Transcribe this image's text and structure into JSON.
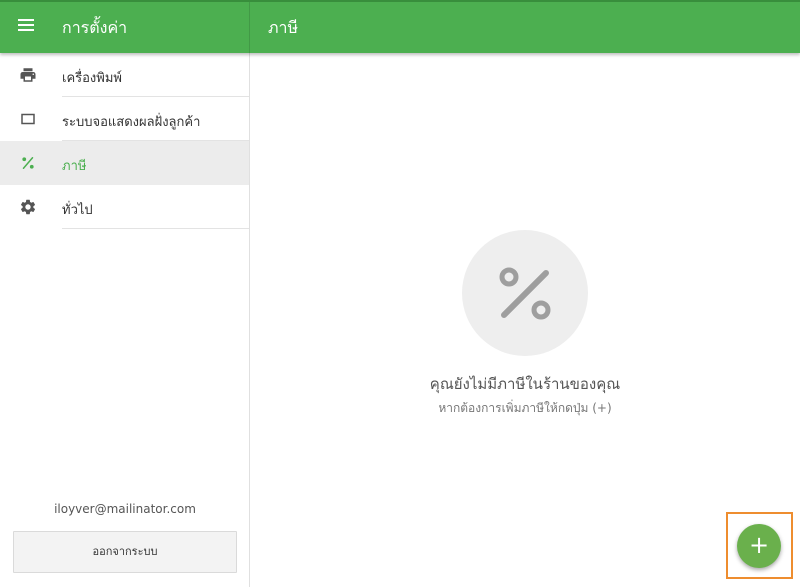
{
  "header": {
    "menu_icon": "hamburger-menu-icon",
    "left_title": "การตั้งค่า",
    "right_title": "ภาษี"
  },
  "sidebar": {
    "items": [
      {
        "label": "เครื่องพิมพ์",
        "icon": "printer-icon",
        "active": false
      },
      {
        "label": "ระบบจอแสดงผลฝั่งลูกค้า",
        "icon": "display-icon",
        "active": false
      },
      {
        "label": "ภาษี",
        "icon": "percent-icon",
        "active": true
      },
      {
        "label": "ทั่วไป",
        "icon": "gear-icon",
        "active": false
      }
    ],
    "email": "iloyver@mailinator.com",
    "logout_label": "ออกจากระบบ"
  },
  "main": {
    "empty_icon": "percent-icon",
    "empty_title": "คุณยังไม่มีภาษีในร้านของคุณ",
    "empty_subtitle": "หากต้องการเพิ่มภาษีให้กดปุ่ม (+)",
    "fab_label": "+",
    "fab_icon": "plus-icon"
  },
  "colors": {
    "primary": "#4caf50",
    "accent": "#6ab04c",
    "highlight": "#ee8d2f"
  }
}
